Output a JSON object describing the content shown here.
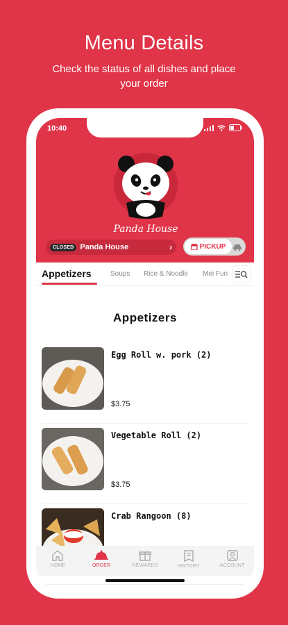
{
  "promo": {
    "title": "Menu Details",
    "subtitle": "Check the status of all dishes and place your order"
  },
  "status_bar": {
    "time": "10:40"
  },
  "store": {
    "status_badge": "CLOSED",
    "name": "Panda House",
    "logo_text": "Panda House"
  },
  "order_mode": {
    "pickup_label": "PICKUP"
  },
  "tabs": [
    "Appetizers",
    "Soups",
    "Rice & Noodle",
    "Mei Fun"
  ],
  "menu": {
    "section_title": "Appetizers",
    "items": [
      {
        "name": "Egg Roll w. pork (2)",
        "price": "$3.75"
      },
      {
        "name": "Vegetable Roll (2)",
        "price": "$3.75"
      },
      {
        "name": "Crab Rangoon (8)",
        "price": ""
      }
    ]
  },
  "bottom_nav": [
    "HOME",
    "ORDER",
    "REWARDS",
    "HISTORY",
    "ACCOUNT"
  ],
  "colors": {
    "brand": "#e03448"
  }
}
